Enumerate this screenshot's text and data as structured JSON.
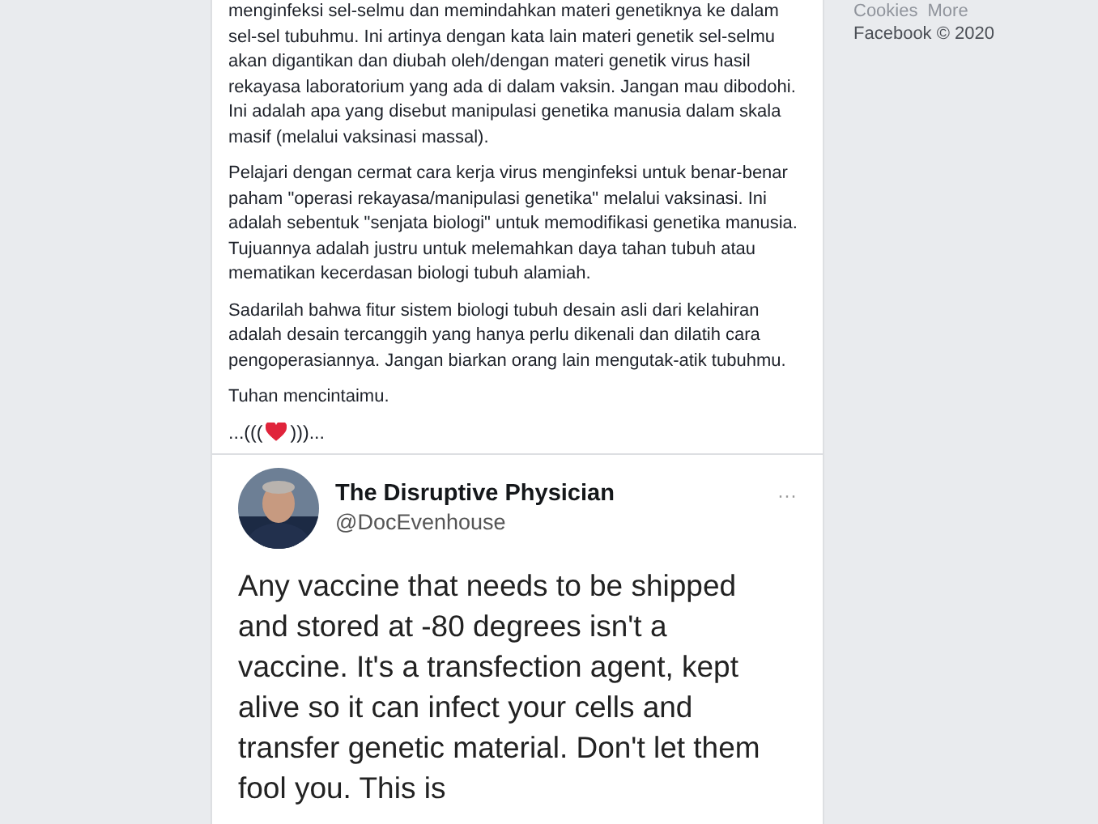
{
  "post": {
    "paragraphs": [
      "menginfeksi sel-selmu dan memindahkan materi genetiknya ke dalam sel-sel tubuhmu. Ini artinya dengan kata lain materi genetik sel-selmu akan digantikan dan diubah oleh/dengan materi genetik virus hasil rekayasa laboratorium yang ada di dalam vaksin. Jangan mau dibodohi. Ini adalah apa yang disebut manipulasi genetika manusia dalam skala masif (melalui vaksinasi massal).",
      "Pelajari dengan cermat cara kerja virus menginfeksi untuk benar-benar paham \"operasi rekayasa/manipulasi genetika\" melalui vaksinasi. Ini adalah sebentuk \"senjata biologi\" untuk memodifikasi genetika manusia. Tujuannya adalah justru untuk melemahkan daya tahan tubuh atau mematikan kecerdasan biologi tubuh alamiah.",
      "Sadarilah bahwa fitur sistem biologi tubuh desain asli dari kelahiran adalah desain tercanggih yang hanya perlu dikenali dan dilatih cara pengoperasiannya. Jangan biarkan orang lain mengutak-atik tubuhmu.",
      "Tuhan mencintaimu."
    ],
    "signature": {
      "before": "...(((",
      "after": ")))..."
    },
    "tweet": {
      "name": "The Disruptive Physician",
      "handle": "@DocEvenhouse",
      "more": "···",
      "text": "Any vaccine that needs to be shipped and stored at -80 degrees isn't a vaccine. It's a transfection agent, kept alive so it can infect your cells and transfer genetic material. Don't let them fool you. This is"
    }
  },
  "sidebar": {
    "links": [
      "Cookies",
      "More"
    ],
    "footer": "Facebook © 2020"
  }
}
